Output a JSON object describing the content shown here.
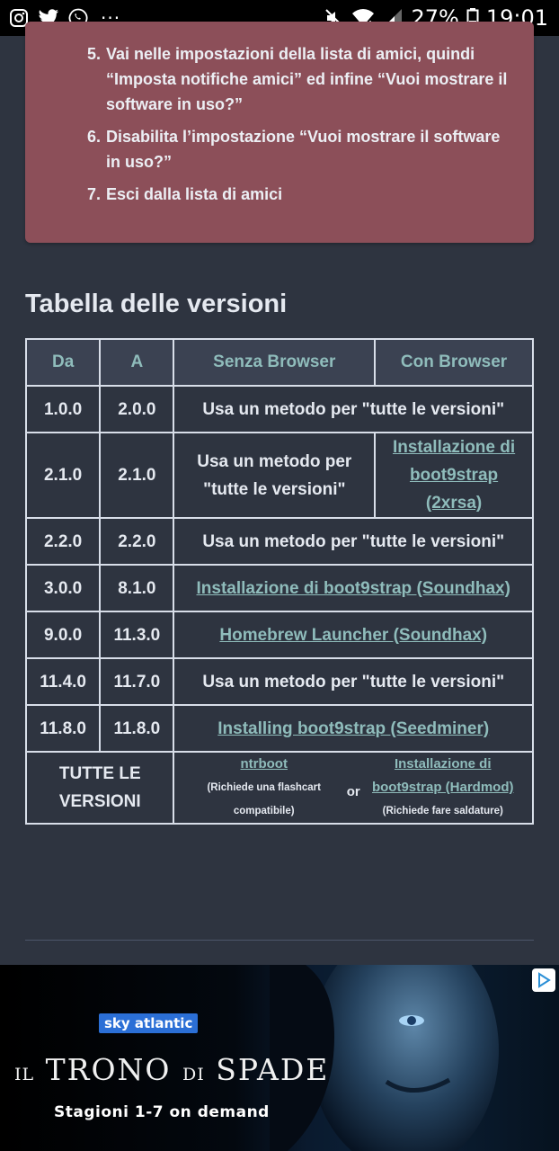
{
  "status_bar": {
    "left_icons": [
      "instagram-icon",
      "twitter-icon",
      "whatsapp-icon"
    ],
    "more": "···",
    "right_icons": [
      "mute-icon",
      "wifi-icon",
      "signal-icon"
    ],
    "battery": "27%",
    "time": "19:01"
  },
  "notice": {
    "items": [
      {
        "num": "5.",
        "text": "Vai nelle impostazioni della lista di amici, quindi “Imposta notifiche amici” ed infine “Vuoi mostrare il software in uso?”"
      },
      {
        "num": "6.",
        "text": "Disabilita l’impostazione “Vuoi mostrare il software in uso?”"
      },
      {
        "num": "7.",
        "text": "Esci dalla lista di amici"
      }
    ]
  },
  "section_title": "Tabella delle versioni",
  "table": {
    "headers": [
      "Da",
      "A",
      "Senza Browser",
      "Con Browser"
    ],
    "rows": [
      {
        "from": "1.0.0",
        "to": "2.0.0",
        "method": "Usa un metodo per \"tutte le versioni\""
      },
      {
        "from": "2.1.0",
        "to": "2.1.0",
        "senza": "Usa un metodo per \"tutte le versioni\"",
        "con": "Installazione di boot9strap (2xrsa)"
      },
      {
        "from": "2.2.0",
        "to": "2.2.0",
        "method": "Usa un metodo per \"tutte le versioni\""
      },
      {
        "from": "3.0.0",
        "to": "8.1.0",
        "method": "Installazione di boot9strap (Soundhax)"
      },
      {
        "from": "9.0.0",
        "to": "11.3.0",
        "method": "Homebrew Launcher (Soundhax)"
      },
      {
        "from": "11.4.0",
        "to": "11.7.0",
        "method": "Usa un metodo per \"tutte le versioni\""
      },
      {
        "from": "11.8.0",
        "to": "11.8.0",
        "method": "Installing boot9strap (Seedminer)"
      }
    ],
    "all_versions": {
      "label": "TUTTE LE VERSIONI",
      "option1_link": "ntrboot",
      "option1_note": "(Richiede una flashcart compatibile)",
      "or": "or",
      "option2_link": "Installazione di boot9strap (Hardmod)",
      "option2_note": "(Richiede fare saldature)"
    }
  },
  "ad": {
    "channel": "sky atlantic",
    "title_prefix": "IL",
    "title_word1": "TRONO",
    "title_mid": "DI",
    "title_word2": "SPADE",
    "subtitle": "Stagioni 1-7 on demand",
    "adchoices_icon": "adchoices-icon"
  }
}
